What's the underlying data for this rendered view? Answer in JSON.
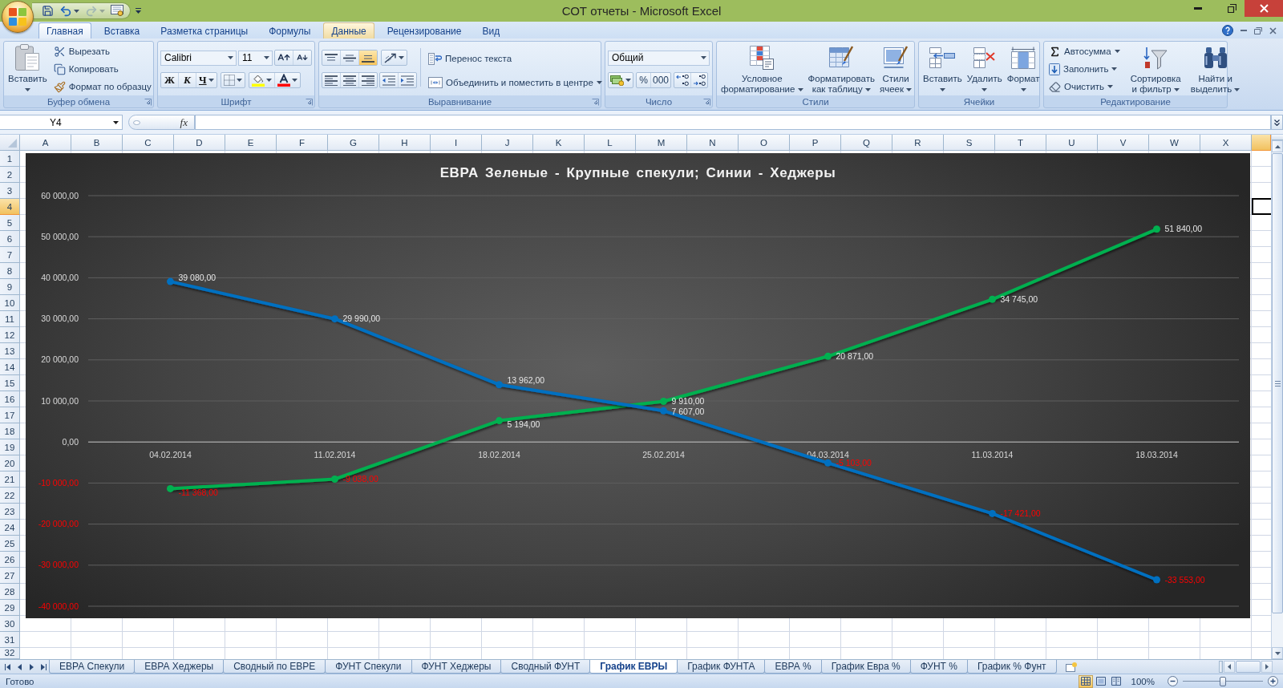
{
  "window": {
    "title": "СОТ отчеты - Microsoft Excel"
  },
  "quick_access": [
    {
      "kind": "save",
      "disabled": false
    },
    {
      "kind": "undo",
      "disabled": false
    },
    {
      "kind": "redo",
      "disabled": true
    },
    {
      "kind": "print-preview",
      "disabled": false
    }
  ],
  "ribbon_tabs": [
    {
      "label": "Главная",
      "selected": true,
      "hovered": false
    },
    {
      "label": "Вставка",
      "selected": false,
      "hovered": false
    },
    {
      "label": "Разметка страницы",
      "selected": false,
      "hovered": false
    },
    {
      "label": "Формулы",
      "selected": false,
      "hovered": false
    },
    {
      "label": "Данные",
      "selected": false,
      "hovered": true
    },
    {
      "label": "Рецензирование",
      "selected": false,
      "hovered": false
    },
    {
      "label": "Вид",
      "selected": false,
      "hovered": false
    }
  ],
  "ribbon_groups": [
    {
      "kind": "clipboard",
      "caption": "Буфер обмена",
      "launcher": true,
      "paste_label": "Вставить",
      "actions": [
        {
          "kind": "cut",
          "label": "Вырезать"
        },
        {
          "kind": "copy",
          "label": "Копировать"
        },
        {
          "kind": "format-painter",
          "label": "Формат по образцу"
        }
      ]
    },
    {
      "kind": "font",
      "caption": "Шрифт",
      "launcher": true,
      "font_name": "Calibri",
      "font_size": "11",
      "styles": [
        {
          "kind": "bold",
          "label": "Ж"
        },
        {
          "kind": "italic",
          "label": "К"
        },
        {
          "kind": "underline",
          "label": "Ч"
        }
      ]
    },
    {
      "kind": "alignment",
      "caption": "Выравнивание",
      "launcher": true,
      "vertical": [
        {
          "kind": "top",
          "selected": false
        },
        {
          "kind": "middle",
          "selected": false
        },
        {
          "kind": "bottom",
          "selected": true
        }
      ],
      "horizontal": [
        {
          "kind": "left",
          "selected": false
        },
        {
          "kind": "center",
          "selected": false
        },
        {
          "kind": "right",
          "selected": false
        }
      ],
      "wrap_text": "Перенос текста",
      "merge": "Объединить и поместить в центре"
    },
    {
      "kind": "number",
      "caption": "Число",
      "launcher": true,
      "format": "Общий",
      "percent": "%",
      "thousands": "000"
    },
    {
      "kind": "styles",
      "caption": "Стили",
      "launcher": false,
      "buttons": [
        {
          "kind": "conditional",
          "lines": [
            "Условное",
            "форматирование"
          ]
        },
        {
          "kind": "table",
          "lines": [
            "Форматировать",
            "как таблицу"
          ]
        },
        {
          "kind": "cell-styles",
          "lines": [
            "Стили",
            "ячеек"
          ]
        }
      ]
    },
    {
      "kind": "cells",
      "caption": "Ячейки",
      "launcher": false,
      "buttons": [
        {
          "kind": "insert",
          "label": "Вставить"
        },
        {
          "kind": "delete",
          "label": "Удалить"
        },
        {
          "kind": "format",
          "label": "Формат"
        }
      ]
    },
    {
      "kind": "editing",
      "caption": "Редактирование",
      "launcher": false,
      "actions": [
        {
          "kind": "autosum",
          "label": "Автосумма"
        },
        {
          "kind": "fill",
          "label": "Заполнить"
        },
        {
          "kind": "clear",
          "label": "Очистить"
        }
      ],
      "buttons": [
        {
          "kind": "sort",
          "lines": [
            "Сортировка",
            "и фильтр"
          ]
        },
        {
          "kind": "find",
          "lines": [
            "Найти и",
            "выделить"
          ]
        }
      ]
    }
  ],
  "formula_bar": {
    "name_box": "Y4",
    "function_label": "fx"
  },
  "grid": {
    "columns": [
      {
        "label": "A",
        "selected": false
      },
      {
        "label": "B",
        "selected": false
      },
      {
        "label": "C",
        "selected": false
      },
      {
        "label": "D",
        "selected": false
      },
      {
        "label": "E",
        "selected": false
      },
      {
        "label": "F",
        "selected": false
      },
      {
        "label": "G",
        "selected": false
      },
      {
        "label": "H",
        "selected": false
      },
      {
        "label": "I",
        "selected": false
      },
      {
        "label": "J",
        "selected": false
      },
      {
        "label": "K",
        "selected": false
      },
      {
        "label": "L",
        "selected": false
      },
      {
        "label": "M",
        "selected": false
      },
      {
        "label": "N",
        "selected": false
      },
      {
        "label": "O",
        "selected": false
      },
      {
        "label": "P",
        "selected": false
      },
      {
        "label": "Q",
        "selected": false
      },
      {
        "label": "R",
        "selected": false
      },
      {
        "label": "S",
        "selected": false
      },
      {
        "label": "T",
        "selected": false
      },
      {
        "label": "U",
        "selected": false
      },
      {
        "label": "V",
        "selected": false
      },
      {
        "label": "W",
        "selected": false
      },
      {
        "label": "X",
        "selected": false
      }
    ],
    "partial_column": {
      "selected": true
    },
    "rows": [
      {
        "label": "1",
        "selected": false
      },
      {
        "label": "2",
        "selected": false
      },
      {
        "label": "3",
        "selected": false
      },
      {
        "label": "4",
        "selected": true
      },
      {
        "label": "5",
        "selected": false
      },
      {
        "label": "6",
        "selected": false
      },
      {
        "label": "7",
        "selected": false
      },
      {
        "label": "8",
        "selected": false
      },
      {
        "label": "9",
        "selected": false
      },
      {
        "label": "10",
        "selected": false
      },
      {
        "label": "11",
        "selected": false
      },
      {
        "label": "12",
        "selected": false
      },
      {
        "label": "13",
        "selected": false
      },
      {
        "label": "14",
        "selected": false
      },
      {
        "label": "15",
        "selected": false
      },
      {
        "label": "16",
        "selected": false
      },
      {
        "label": "17",
        "selected": false
      },
      {
        "label": "18",
        "selected": false
      },
      {
        "label": "19",
        "selected": false
      },
      {
        "label": "20",
        "selected": false
      },
      {
        "label": "21",
        "selected": false
      },
      {
        "label": "22",
        "selected": false
      },
      {
        "label": "23",
        "selected": false
      },
      {
        "label": "24",
        "selected": false
      },
      {
        "label": "25",
        "selected": false
      },
      {
        "label": "26",
        "selected": false
      },
      {
        "label": "27",
        "selected": false
      },
      {
        "label": "28",
        "selected": false
      },
      {
        "label": "29",
        "selected": false
      },
      {
        "label": "30",
        "selected": false
      },
      {
        "label": "31",
        "selected": false
      },
      {
        "label": "32",
        "selected": false
      }
    ],
    "chart": {
      "chart_data": {
        "type": "line",
        "title": "ЕВРА Зеленые - Крупные спекули; Синии - Хеджеры",
        "categories": [
          "04.02.2014",
          "11.02.2014",
          "18.02.2014",
          "25.02.2014",
          "04.03.2014",
          "11.03.2014",
          "18.03.2014"
        ],
        "series": [
          {
            "color": "#00b050",
            "marker": true,
            "values": [
              -11368,
              -9038,
              5194,
              9910,
              20871,
              34745,
              51840
            ],
            "value_labels": [
              "-11 368,00",
              "-9 038,00",
              "5 194,00",
              "9 910,00",
              "20 871,00",
              "34 745,00",
              "51 840,00"
            ]
          },
          {
            "color": "#0070c0",
            "marker": true,
            "values": [
              39080,
              29990,
              13962,
              7607,
              -5103,
              -17421,
              -33553
            ],
            "value_labels": [
              "39 080,00",
              "29 990,00",
              "13 962,00",
              "7 607,00",
              "-5 103,00",
              "-17 421,00",
              "-33 553,00"
            ]
          }
        ],
        "ylim": [
          -40000,
          60000
        ],
        "yticks": [
          {
            "value": 60000,
            "label": "60 000,00"
          },
          {
            "value": 50000,
            "label": "50 000,00"
          },
          {
            "value": 40000,
            "label": "40 000,00"
          },
          {
            "value": 30000,
            "label": "30 000,00"
          },
          {
            "value": 20000,
            "label": "20 000,00"
          },
          {
            "value": 10000,
            "label": "10 000,00"
          },
          {
            "value": 0,
            "label": "0,00"
          },
          {
            "value": -10000,
            "label": "-10 000,00"
          },
          {
            "value": -20000,
            "label": "-20 000,00"
          },
          {
            "value": -30000,
            "label": "-30 000,00"
          },
          {
            "value": -40000,
            "label": "-40 000,00"
          }
        ],
        "grid": true,
        "data_labels": true
      }
    }
  },
  "sheet_tabs": [
    {
      "label": "ЕВРА Спекули",
      "selected": false
    },
    {
      "label": "ЕВРА Хеджеры",
      "selected": false
    },
    {
      "label": "Сводный по ЕВРЕ",
      "selected": false
    },
    {
      "label": "ФУНТ Спекули",
      "selected": false
    },
    {
      "label": "ФУНТ Хеджеры",
      "selected": false
    },
    {
      "label": "Сводный ФУНТ",
      "selected": false
    },
    {
      "label": "График ЕВРЫ",
      "selected": true
    },
    {
      "label": "График ФУНТА",
      "selected": false
    },
    {
      "label": "ЕВРА %",
      "selected": false
    },
    {
      "label": "График Евра %",
      "selected": false
    },
    {
      "label": "ФУНТ %",
      "selected": false
    },
    {
      "label": "График % Фунт",
      "selected": false
    }
  ],
  "status_bar": {
    "status": "Готово",
    "views": [
      {
        "kind": "normal",
        "selected": true
      },
      {
        "kind": "page-layout",
        "selected": false
      },
      {
        "kind": "page-break",
        "selected": false
      }
    ],
    "zoom": {
      "label": "100%",
      "level": 0.5
    }
  }
}
